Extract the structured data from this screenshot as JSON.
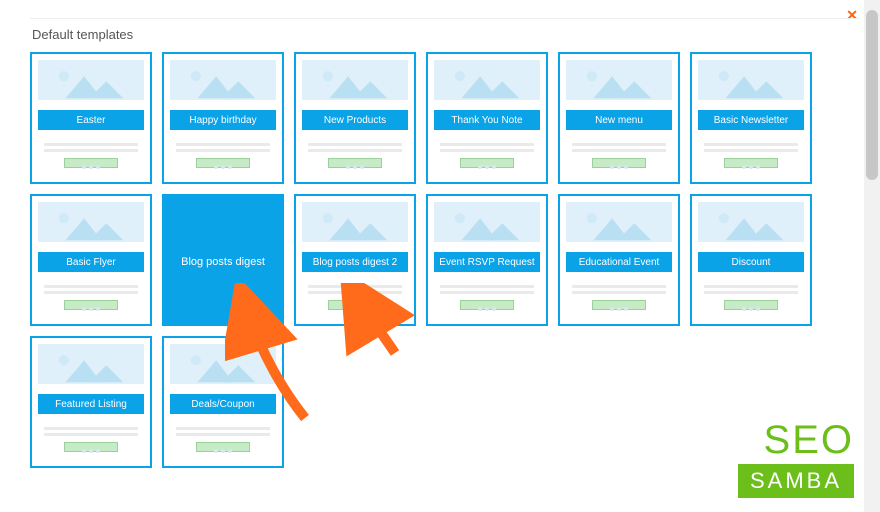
{
  "section_title": "Default templates",
  "templates": [
    {
      "label": "Easter"
    },
    {
      "label": "Happy birthday"
    },
    {
      "label": "New Products"
    },
    {
      "label": "Thank You Note"
    },
    {
      "label": "New menu"
    },
    {
      "label": "Basic Newsletter"
    },
    {
      "label": "Basic Flyer"
    },
    {
      "label": "Blog posts digest",
      "hovered": true
    },
    {
      "label": "Blog posts digest 2"
    },
    {
      "label": "Event RSVP Request"
    },
    {
      "label": "Educational Event"
    },
    {
      "label": "Discount"
    },
    {
      "label": "Featured Listing"
    },
    {
      "label": "Deals/Coupon"
    }
  ],
  "logo": {
    "top": "SEO",
    "bottom": "SAMBA"
  },
  "close_glyph": "✕"
}
